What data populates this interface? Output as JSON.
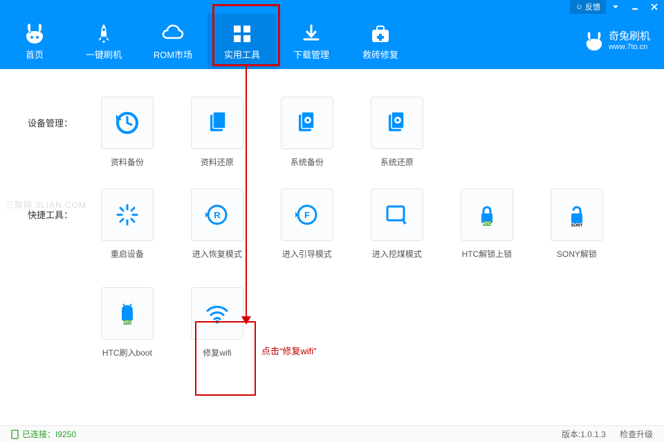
{
  "titlebar": {
    "feedback": "反馈"
  },
  "nav": {
    "items": [
      {
        "label": "首页"
      },
      {
        "label": "一键刷机"
      },
      {
        "label": "ROM市场"
      },
      {
        "label": "实用工具"
      },
      {
        "label": "下载管理"
      },
      {
        "label": "救砖修复"
      }
    ]
  },
  "brand": {
    "name": "奇兔刷机",
    "url": "www.7to.cn"
  },
  "sections": {
    "device_mgmt": {
      "label": "设备管理：",
      "tiles": [
        {
          "label": "资料备份"
        },
        {
          "label": "资料还原"
        },
        {
          "label": "系统备份"
        },
        {
          "label": "系统还原"
        }
      ]
    },
    "quick_tools": {
      "label": "快捷工具：",
      "tiles": [
        {
          "label": "重启设备"
        },
        {
          "label": "进入恢复模式"
        },
        {
          "label": "进入引导模式"
        },
        {
          "label": "进入挖煤模式"
        },
        {
          "label": "HTC解锁上锁"
        },
        {
          "label": "SONY解锁"
        },
        {
          "label": "HTC刷入boot"
        },
        {
          "label": "修复wifi"
        }
      ]
    }
  },
  "watermark": "三联网 3LIAN.COM",
  "callout": "点击“修复wifi”",
  "status": {
    "connected": "已连接：I9250",
    "version": "版本:1.0.1.3",
    "check_update": "检查升级"
  },
  "badges": {
    "htc": "HTC",
    "sony": "SONY"
  }
}
